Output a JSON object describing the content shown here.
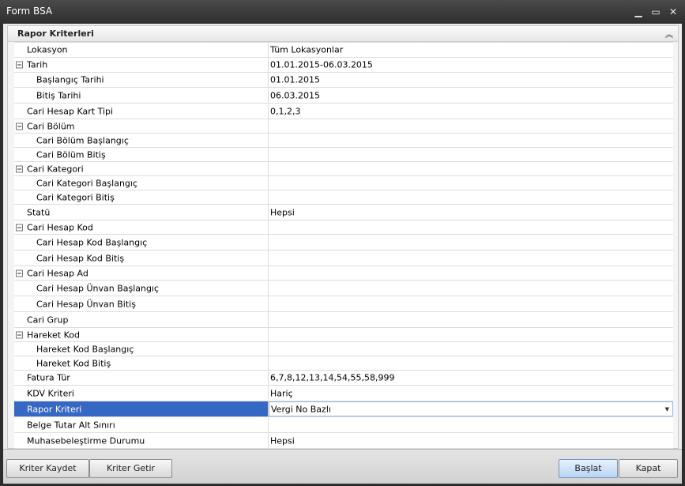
{
  "window": {
    "title": "Form BSA",
    "controls": [
      "minimize-icon",
      "maximize-icon",
      "close-icon"
    ]
  },
  "group": {
    "title": "Rapor Kriterleri"
  },
  "rows": [
    {
      "label": "Lokasyon",
      "value": "Tüm Lokasyonlar",
      "level": 0,
      "expander": false
    },
    {
      "label": "Tarih",
      "value": "01.01.2015-06.03.2015",
      "level": 0,
      "expander": true
    },
    {
      "label": "Başlangıç Tarihi",
      "value": "01.01.2015",
      "level": 1,
      "expander": false
    },
    {
      "label": "Bitiş Tarihi",
      "value": "06.03.2015",
      "level": 1,
      "expander": false
    },
    {
      "label": "Cari Hesap Kart Tipi",
      "value": "0,1,2,3",
      "level": 0,
      "expander": false
    },
    {
      "label": "Cari Bölüm",
      "value": "",
      "level": 0,
      "expander": true
    },
    {
      "label": "Cari Bölüm Başlangıç",
      "value": "",
      "level": 1,
      "expander": false
    },
    {
      "label": "Cari Bölüm Bitiş",
      "value": "",
      "level": 1,
      "expander": false
    },
    {
      "label": "Cari Kategori",
      "value": "",
      "level": 0,
      "expander": true
    },
    {
      "label": "Cari Kategori Başlangıç",
      "value": "",
      "level": 1,
      "expander": false
    },
    {
      "label": "Cari Kategori Bitiş",
      "value": "",
      "level": 1,
      "expander": false
    },
    {
      "label": "Statü",
      "value": "Hepsi",
      "level": 0,
      "expander": false
    },
    {
      "label": "Cari Hesap Kod",
      "value": "",
      "level": 0,
      "expander": true
    },
    {
      "label": "Cari Hesap Kod Başlangıç",
      "value": "",
      "level": 1,
      "expander": false
    },
    {
      "label": "Cari Hesap Kod Bitiş",
      "value": "",
      "level": 1,
      "expander": false
    },
    {
      "label": "Cari Hesap Ad",
      "value": "",
      "level": 0,
      "expander": true
    },
    {
      "label": "Cari Hesap Ünvan Başlangıç",
      "value": "",
      "level": 1,
      "expander": false
    },
    {
      "label": "Cari Hesap Ünvan Bitiş",
      "value": "",
      "level": 1,
      "expander": false
    },
    {
      "label": "Cari Grup",
      "value": "",
      "level": 0,
      "expander": false
    },
    {
      "label": "Hareket Kod",
      "value": "",
      "level": 0,
      "expander": true
    },
    {
      "label": "Hareket Kod Başlangıç",
      "value": "",
      "level": 1,
      "expander": false
    },
    {
      "label": "Hareket Kod Bitiş",
      "value": "",
      "level": 1,
      "expander": false
    },
    {
      "label": "Fatura Tür",
      "value": "6,7,8,12,13,14,54,55,58,999",
      "level": 0,
      "expander": false
    },
    {
      "label": "KDV Kriteri",
      "value": "Hariç",
      "level": 0,
      "expander": false
    },
    {
      "label": "Rapor Kriteri",
      "value": "Vergi No Bazlı",
      "level": 0,
      "expander": false,
      "selected": true,
      "dropdown": true
    },
    {
      "label": "Belge Tutar Alt Sınırı",
      "value": "",
      "level": 0,
      "expander": false
    },
    {
      "label": "Muhasebeleştirme Durumu",
      "value": "Hepsi",
      "level": 0,
      "expander": false
    }
  ],
  "footer": {
    "save_criteria": "Kriter Kaydet",
    "load_criteria": "Kriter Getir",
    "start": "Başlat",
    "close": "Kapat"
  },
  "colors": {
    "selection": "#3567c4",
    "titlebar": "#2e2e2e"
  }
}
